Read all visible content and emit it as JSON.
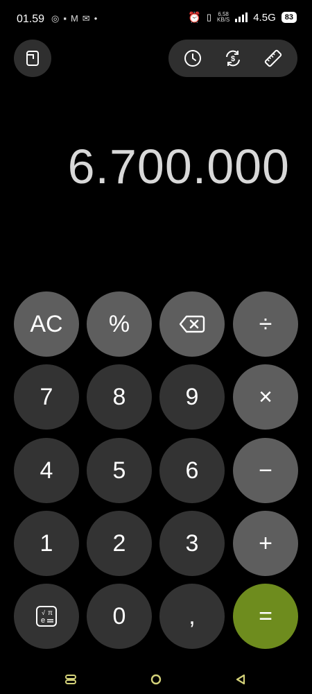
{
  "status_bar": {
    "time": "01.59",
    "speed_value": "6,58",
    "speed_unit": "KB/S",
    "network": "4.5G",
    "battery": "83"
  },
  "display": {
    "value": "6.700.000"
  },
  "keys": {
    "clear": "AC",
    "percent": "%",
    "divide": "÷",
    "seven": "7",
    "eight": "8",
    "nine": "9",
    "multiply": "×",
    "four": "4",
    "five": "5",
    "six": "6",
    "subtract": "−",
    "one": "1",
    "two": "2",
    "three": "3",
    "add": "+",
    "zero": "0",
    "decimal": ",",
    "equals": "="
  },
  "colors": {
    "number_key": "#333333",
    "function_key": "#5e5e5e",
    "equals_key": "#6e8c1e",
    "display_text": "#d8d8d8"
  }
}
